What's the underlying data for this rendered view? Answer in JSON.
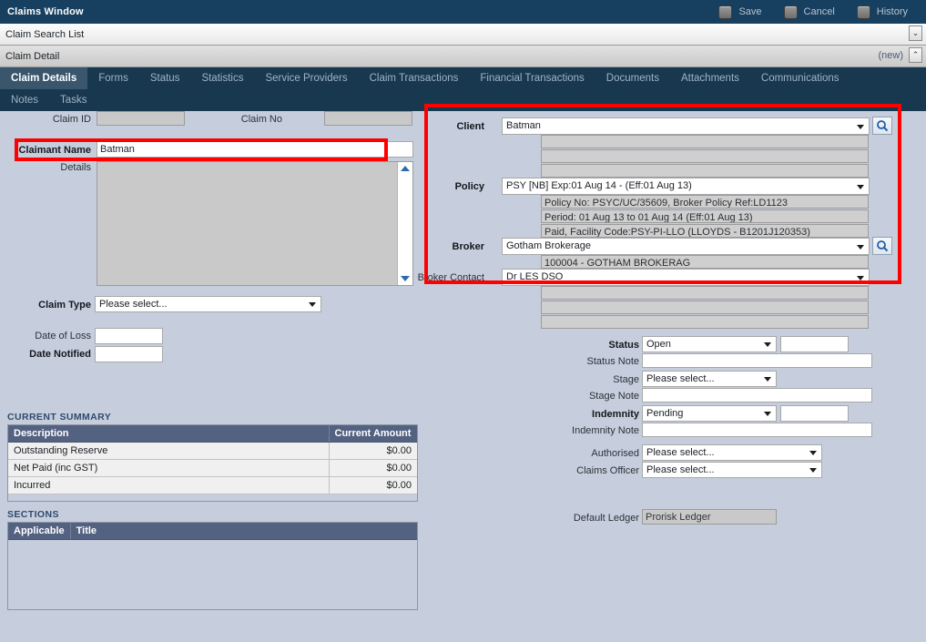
{
  "window": {
    "title": "Claims Window",
    "tools": [
      {
        "label": "Save",
        "icon": "save-icon"
      },
      {
        "label": "Cancel",
        "icon": "cancel-icon"
      },
      {
        "label": "History",
        "icon": "history-icon"
      }
    ]
  },
  "panels": {
    "search_list": {
      "title": "Claim Search List",
      "chevron": "⌄"
    },
    "detail": {
      "title": "Claim Detail",
      "status": "(new)",
      "chevron": "⌃"
    }
  },
  "tabs": {
    "row1": [
      {
        "label": "Claim Details",
        "active": true
      },
      {
        "label": "Forms",
        "active": false
      },
      {
        "label": "Status",
        "active": false
      },
      {
        "label": "Statistics",
        "active": false
      },
      {
        "label": "Service Providers",
        "active": false
      },
      {
        "label": "Claim Transactions",
        "active": false
      },
      {
        "label": "Financial Transactions",
        "active": false
      },
      {
        "label": "Documents",
        "active": false
      },
      {
        "label": "Attachments",
        "active": false
      },
      {
        "label": "Communications",
        "active": false
      }
    ],
    "row2": [
      {
        "label": "Notes",
        "active": false
      },
      {
        "label": "Tasks",
        "active": false
      }
    ]
  },
  "left": {
    "claim_id": {
      "label": "Claim ID",
      "value": ""
    },
    "claim_no": {
      "label": "Claim No",
      "value": ""
    },
    "claimant_name": {
      "label": "Claimant Name",
      "value": "Batman"
    },
    "details": {
      "label": "Details",
      "value": ""
    },
    "claim_type": {
      "label": "Claim Type",
      "value": "Please select..."
    },
    "date_of_loss": {
      "label": "Date of Loss",
      "value": ""
    },
    "date_notified": {
      "label": "Date Notified",
      "value": ""
    }
  },
  "summary": {
    "caption": "CURRENT SUMMARY",
    "columns": [
      "Description",
      "Current Amount"
    ],
    "rows": [
      {
        "description": "Outstanding Reserve",
        "amount": "$0.00"
      },
      {
        "description": "Net Paid (inc GST)",
        "amount": "$0.00"
      },
      {
        "description": "Incurred",
        "amount": "$0.00"
      }
    ]
  },
  "sections": {
    "caption": "SECTIONS",
    "columns": [
      "Applicable",
      "Title"
    ],
    "rows": []
  },
  "right": {
    "client": {
      "label": "Client",
      "value": "Batman",
      "search_icon": "search-icon",
      "extra_rows": [
        "",
        "",
        ""
      ]
    },
    "policy": {
      "label": "Policy",
      "value": "PSY [NB] Exp:01 Aug 14 -  (Eff:01 Aug 13)",
      "info_rows": [
        "Policy No: PSYC/UC/35609, Broker Policy Ref:LD1123",
        "Period: 01 Aug 13 to 01 Aug 14 (Eff:01 Aug 13)",
        "Paid, Facility Code:PSY-PI-LLO (LLOYDS - B1201J120353)"
      ]
    },
    "broker": {
      "label": "Broker",
      "value": "Gotham Brokerage",
      "search_icon": "search-icon",
      "info_rows": [
        "100004 - GOTHAM BROKERAG"
      ]
    },
    "broker_contact": {
      "label": "Broker Contact",
      "value": "Dr LES DSO",
      "extra_rows": [
        "",
        "",
        ""
      ]
    },
    "status": {
      "label": "Status",
      "value": "Open",
      "side_value": ""
    },
    "status_note": {
      "label": "Status Note",
      "value": ""
    },
    "stage": {
      "label": "Stage",
      "value": "Please select..."
    },
    "stage_note": {
      "label": "Stage Note",
      "value": ""
    },
    "indemnity": {
      "label": "Indemnity",
      "value": "Pending",
      "side_value": ""
    },
    "indemnity_note": {
      "label": "Indemnity Note",
      "value": ""
    },
    "authorised": {
      "label": "Authorised",
      "value": "Please select..."
    },
    "claims_officer": {
      "label": "Claims Officer",
      "value": "Please select..."
    },
    "default_ledger": {
      "label": "Default Ledger",
      "value": "Prorisk Ledger"
    }
  },
  "colors": {
    "titlebar": "#173f5f",
    "tabstrip": "#18384f",
    "active_tab": "#39566d",
    "page_bg": "#c6cedd",
    "grid_header": "#546282",
    "annotation": "#ff0000",
    "caption": "#2f4a6d"
  }
}
